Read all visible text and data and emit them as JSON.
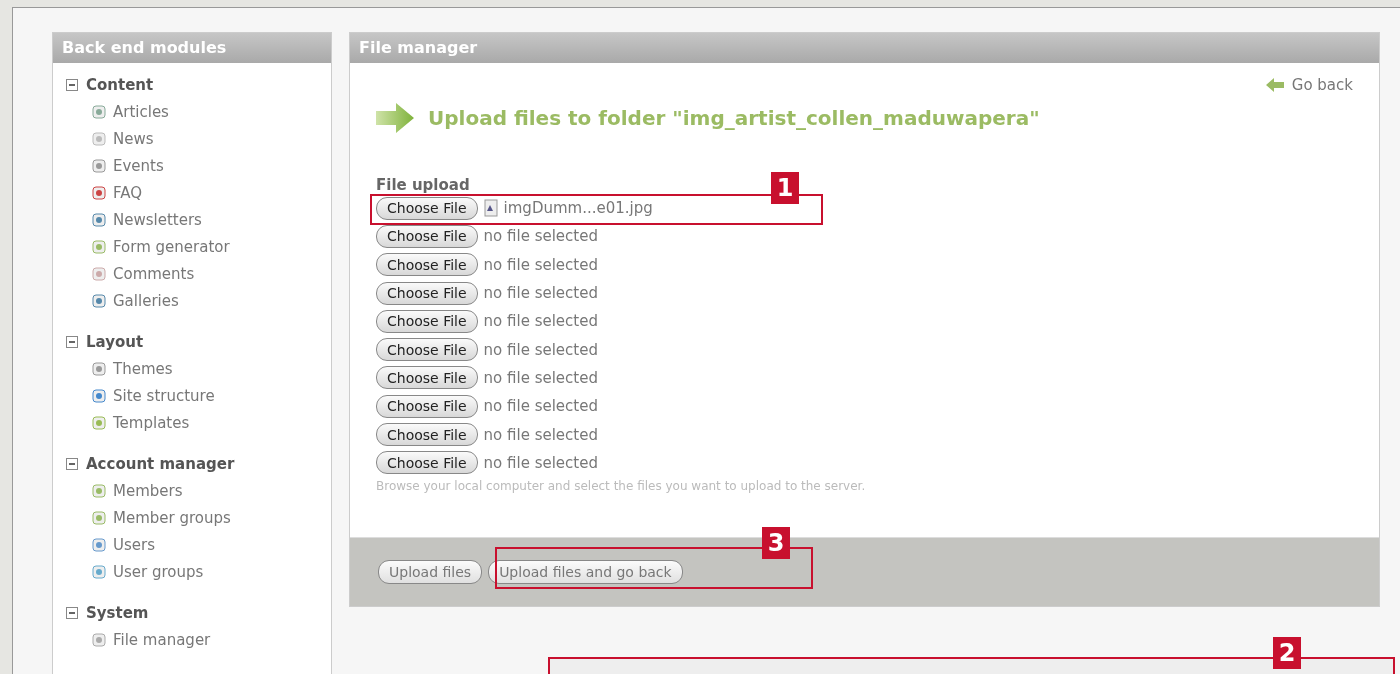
{
  "sidebar": {
    "title": "Back end modules",
    "groups": [
      {
        "label": "Content",
        "expanded": true,
        "items": [
          "Articles",
          "News",
          "Events",
          "FAQ",
          "Newsletters",
          "Form generator",
          "Comments",
          "Galleries"
        ]
      },
      {
        "label": "Layout",
        "expanded": true,
        "items": [
          "Themes",
          "Site structure",
          "Templates"
        ]
      },
      {
        "label": "Account manager",
        "expanded": true,
        "items": [
          "Members",
          "Member groups",
          "Users",
          "User groups"
        ]
      },
      {
        "label": "System",
        "expanded": true,
        "items": [
          "File manager"
        ]
      }
    ]
  },
  "main": {
    "title": "File manager",
    "go_back": "Go back",
    "heading": "Upload files to folder \"img_artist_collen_maduwapera\"",
    "upload_label": "File upload",
    "rows": [
      {
        "button": "Choose File",
        "file": "imgDumm...e01.jpg",
        "has_file": true
      },
      {
        "button": "Choose File",
        "file": "no file selected",
        "has_file": false
      },
      {
        "button": "Choose File",
        "file": "no file selected",
        "has_file": false
      },
      {
        "button": "Choose File",
        "file": "no file selected",
        "has_file": false
      },
      {
        "button": "Choose File",
        "file": "no file selected",
        "has_file": false
      },
      {
        "button": "Choose File",
        "file": "no file selected",
        "has_file": false
      },
      {
        "button": "Choose File",
        "file": "no file selected",
        "has_file": false
      },
      {
        "button": "Choose File",
        "file": "no file selected",
        "has_file": false
      },
      {
        "button": "Choose File",
        "file": "no file selected",
        "has_file": false
      },
      {
        "button": "Choose File",
        "file": "no file selected",
        "has_file": false
      }
    ],
    "hint": "Browse your local computer and select the files you want to upload to the server.",
    "buttons": [
      "Upload files",
      "Upload files and go back"
    ]
  },
  "callouts": [
    {
      "label": "1"
    },
    {
      "label": "3"
    },
    {
      "label": "2"
    }
  ]
}
